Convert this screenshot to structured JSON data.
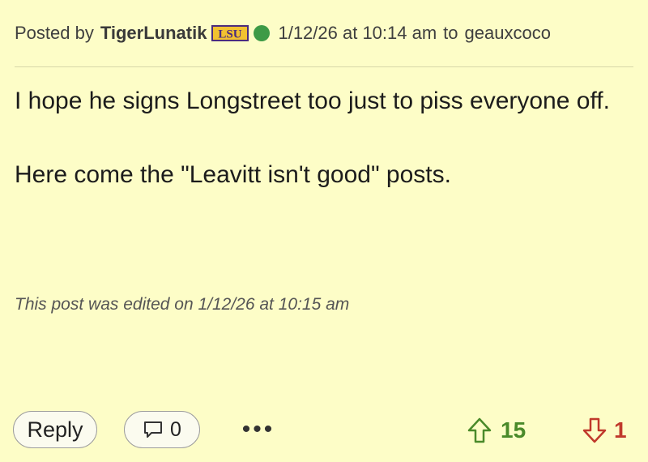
{
  "post": {
    "posted_by_label": "Posted by",
    "username": "TigerLunatik",
    "team_logo_text": "LSU",
    "timestamp": "1/12/26 at 10:14 am",
    "to_word": "to",
    "reply_to_user": "geauxcoco",
    "body_line1": "I hope he signs Longstreet too just to piss everyone off.",
    "body_line2": "Here come the \"Leavitt isn't good\" posts.",
    "edited_note": "This post was edited on 1/12/26 at 10:15 am"
  },
  "footer": {
    "reply_label": "Reply",
    "comment_count": "0",
    "more_label": "•••",
    "upvotes": "15",
    "downvotes": "1"
  },
  "colors": {
    "background": "#fdfdc7",
    "online": "#3d9a46",
    "upvote": "#4a8a2a",
    "downvote": "#c0392b",
    "lsu_purple": "#4b2c7e",
    "lsu_gold": "#f2c230"
  },
  "icons": {
    "online": "online-dot-icon",
    "comment": "comment-bubble-icon",
    "upvote": "arrow-up-icon",
    "downvote": "arrow-down-icon",
    "team": "lsu-logo-icon"
  }
}
